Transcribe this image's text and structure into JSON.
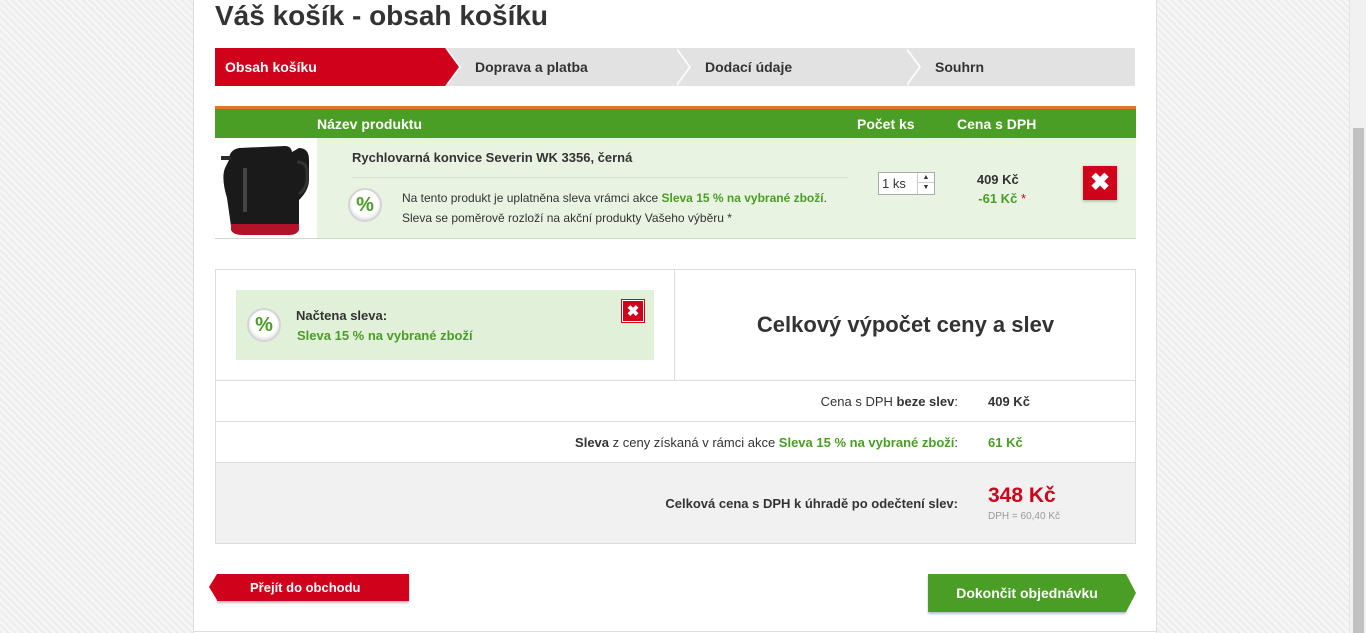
{
  "page": {
    "title": "Váš košík - obsah košíku"
  },
  "steps": [
    {
      "label": "Obsah košíku",
      "active": true
    },
    {
      "label": "Doprava a platba",
      "active": false
    },
    {
      "label": "Dodací údaje",
      "active": false
    },
    {
      "label": "Souhrn",
      "active": false
    }
  ],
  "cart": {
    "columns": {
      "name": "Název produktu",
      "qty": "Počet ks",
      "price": "Cena s DPH"
    },
    "item": {
      "name": "Rychlovarná konvice Severin WK 3356, černá",
      "note_prefix": "Na tento produkt je uplatněna sleva vrámci akce",
      "note_promo": "Sleva 15 % na vybrané zboží",
      "note_suffix": ".",
      "note_line2": "Sleva se poměrově rozloží na akční produkty Vašeho výběru *",
      "qty": "1 ks",
      "price": "409 Kč",
      "discount": "-61 Kč",
      "asterisk": "*",
      "delete": "✖"
    },
    "badge": "%"
  },
  "voucher": {
    "title": "Načtena sleva:",
    "name": "Sleva 15 % na vybrané zboží",
    "delete": "✖"
  },
  "summary": {
    "title": "Celkový výpočet ceny a slev",
    "line1": {
      "prefix": "Cena s DPH ",
      "bold": "beze slev",
      "suffix": ":",
      "value": "409 Kč"
    },
    "line2": {
      "bold": "Sleva",
      "middle": " z ceny získaná v rámci akce ",
      "promo": "Sleva 15 % na vybrané zboží",
      "suffix": ":",
      "value": "61 Kč"
    },
    "total": {
      "label": "Celková cena s DPH k úhradě po odečtení slev:",
      "value": "348 Kč",
      "vat": "DPH = 60,40 Kč"
    }
  },
  "buttons": {
    "back": "Přejít do obchodu",
    "finish": "Dokončit objednávku"
  },
  "colors": {
    "red": "#d0021b",
    "green": "#4a9d25",
    "orange": "#e0762c",
    "light_green": "#e8f3e1"
  }
}
